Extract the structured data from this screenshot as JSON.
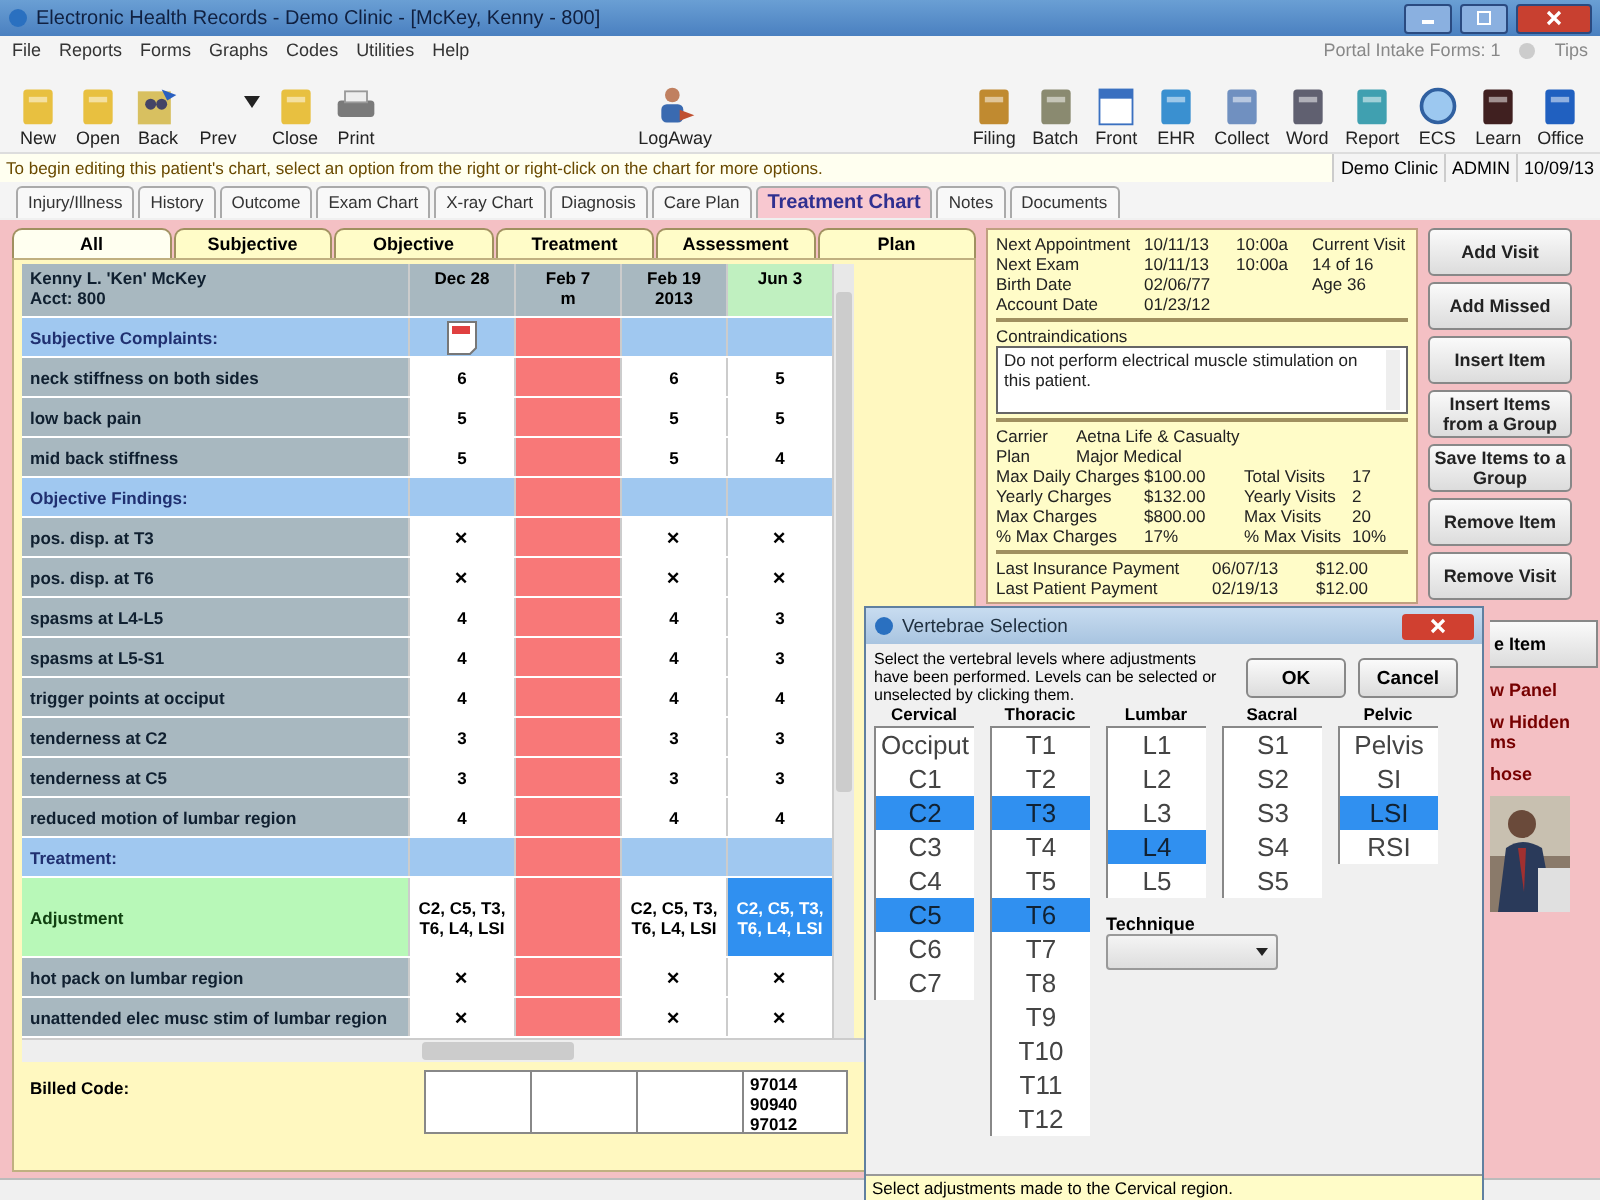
{
  "window": {
    "title": "Electronic Health Records - Demo Clinic - [McKey, Kenny - 800]"
  },
  "menu": [
    "File",
    "Reports",
    "Forms",
    "Graphs",
    "Codes",
    "Utilities",
    "Help"
  ],
  "portal": {
    "label": "Portal Intake Forms: 1",
    "tips": "Tips"
  },
  "toolbar_left": [
    {
      "label": "New"
    },
    {
      "label": "Open"
    },
    {
      "label": "Back"
    },
    {
      "label": "Prev",
      "dropdown": true
    },
    {
      "label": "Close"
    },
    {
      "label": "Print"
    }
  ],
  "toolbar_center": [
    {
      "label": "LogAway"
    }
  ],
  "toolbar_right": [
    {
      "label": "Filing"
    },
    {
      "label": "Batch"
    },
    {
      "label": "Front"
    },
    {
      "label": "EHR"
    },
    {
      "label": "Collect"
    },
    {
      "label": "Word"
    },
    {
      "label": "Report"
    },
    {
      "label": "ECS"
    },
    {
      "label": "Learn"
    },
    {
      "label": "Office"
    }
  ],
  "hint": "To begin editing this patient's chart, select an option from the right or right-click on the chart for more options.",
  "status_cells": [
    "Demo Clinic",
    "ADMIN",
    "10/09/13"
  ],
  "tabs": [
    {
      "label": "Injury/Illness",
      "selected": false
    },
    {
      "label": "History",
      "selected": false
    },
    {
      "label": "Outcome",
      "selected": false
    },
    {
      "label": "Exam Chart",
      "selected": false
    },
    {
      "label": "X-ray Chart",
      "selected": false
    },
    {
      "label": "Diagnosis",
      "selected": false
    },
    {
      "label": "Care Plan",
      "selected": false
    },
    {
      "label": "Treatment Chart",
      "selected": true
    },
    {
      "label": "Notes",
      "selected": false
    },
    {
      "label": "Documents",
      "selected": false
    }
  ],
  "chart_tabs": [
    {
      "label": "All",
      "selected": true
    },
    {
      "label": "Subjective",
      "selected": false
    },
    {
      "label": "Objective",
      "selected": false
    },
    {
      "label": "Treatment",
      "selected": false
    },
    {
      "label": "Assessment",
      "selected": false
    },
    {
      "label": "Plan",
      "selected": false
    }
  ],
  "patient": {
    "name": "Kenny L. 'Ken' McKey",
    "account": "Acct: 800"
  },
  "columns": [
    {
      "date": "Dec 28",
      "note": true,
      "missed": false,
      "current": false
    },
    {
      "date": "Feb 7",
      "sub": "m",
      "note": false,
      "missed": true,
      "current": false
    },
    {
      "date": "Feb 19",
      "sub": "2013",
      "note": false,
      "missed": false,
      "current": false
    },
    {
      "date": "Jun 3",
      "note": false,
      "missed": false,
      "current": true,
      "billed_codes": [
        "97014",
        "90940",
        "97012"
      ]
    }
  ],
  "rows": [
    {
      "kind": "section",
      "label": "Subjective Complaints:"
    },
    {
      "kind": "item",
      "label": "neck stiffness on both sides",
      "values": [
        "6",
        "6",
        "5"
      ]
    },
    {
      "kind": "item",
      "label": "low back pain",
      "values": [
        "5",
        "5",
        "5"
      ]
    },
    {
      "kind": "item",
      "label": "mid back stiffness",
      "values": [
        "5",
        "5",
        "4"
      ]
    },
    {
      "kind": "section",
      "label": "Objective Findings:"
    },
    {
      "kind": "item",
      "label": "pos. disp. at T3",
      "values": [
        "✕",
        "✕",
        "✕"
      ]
    },
    {
      "kind": "item",
      "label": "pos. disp. at T6",
      "values": [
        "✕",
        "✕",
        "✕"
      ]
    },
    {
      "kind": "item",
      "label": "spasms at L4-L5",
      "values": [
        "4",
        "4",
        "3"
      ]
    },
    {
      "kind": "item",
      "label": "spasms at L5-S1",
      "values": [
        "4",
        "4",
        "3"
      ]
    },
    {
      "kind": "item",
      "label": "trigger points at occiput",
      "values": [
        "4",
        "4",
        "4"
      ]
    },
    {
      "kind": "item",
      "label": "tenderness at C2",
      "values": [
        "3",
        "3",
        "3"
      ]
    },
    {
      "kind": "item",
      "label": "tenderness at C5",
      "values": [
        "3",
        "3",
        "3"
      ]
    },
    {
      "kind": "item",
      "label": "reduced motion of lumbar region",
      "values": [
        "4",
        "4",
        "4"
      ]
    },
    {
      "kind": "section",
      "label": "Treatment:"
    },
    {
      "kind": "adjustment",
      "label": "Adjustment",
      "values": [
        "C2, C5, T3, T6, L4, LSI",
        "C2, C5, T3, T6, L4, LSI",
        "C2, C5, T3, T6, L4, LSI"
      ],
      "selected": [
        false,
        false,
        true
      ]
    },
    {
      "kind": "item",
      "label": "hot pack on lumbar region",
      "values": [
        "✕",
        "✕",
        "✕"
      ]
    },
    {
      "kind": "item",
      "label": "unattended elec musc stim of lumbar region",
      "values": [
        "✕",
        "✕",
        "✕"
      ]
    }
  ],
  "billed_label": "Billed Code:",
  "appointments": [
    {
      "label": "Next Appointment",
      "date": "10/11/13",
      "time": "10:00a",
      "extra": "Current Visit"
    },
    {
      "label": "Next Exam",
      "date": "10/11/13",
      "time": "10:00a",
      "extra": "14 of 16"
    },
    {
      "label": "Birth Date",
      "date": "02/06/77",
      "extra": "Age 36"
    },
    {
      "label": "Account Date",
      "date": "01/23/12"
    }
  ],
  "contraindications": {
    "label": "Contraindications",
    "text": "Do not perform electrical muscle stimulation on this patient."
  },
  "insurance": [
    {
      "label": "Carrier",
      "value": "Aetna Life & Casualty"
    },
    {
      "label": "Plan",
      "value": "Major Medical"
    }
  ],
  "charges": [
    {
      "label": "Max Daily Charges",
      "value": "$100.00",
      "label2": "Total Visits",
      "value2": "17"
    },
    {
      "label": "Yearly Charges",
      "value": "$132.00",
      "label2": "Yearly Visits",
      "value2": "2"
    },
    {
      "label": "Max Charges",
      "value": "$800.00",
      "label2": "Max Visits",
      "value2": "20"
    },
    {
      "label": "% Max Charges",
      "value": "17%",
      "label2": "% Max Visits",
      "value2": "10%"
    }
  ],
  "payments": [
    {
      "label": "Last Insurance Payment",
      "date": "06/07/13",
      "amount": "$12.00"
    },
    {
      "label": "Last Patient Payment",
      "date": "02/19/13",
      "amount": "$12.00"
    }
  ],
  "actions": [
    "Add Visit",
    "Add Missed",
    "Insert Item",
    "Insert Items from a Group",
    "Save Items to a Group",
    "Remove Item",
    "Remove Visit"
  ],
  "partial_actions": [
    {
      "kind": "button",
      "label": "e Item"
    },
    {
      "kind": "link",
      "label": "w Panel"
    },
    {
      "kind": "link",
      "label": "w Hidden ms"
    },
    {
      "kind": "link",
      "label": "hose"
    },
    {
      "kind": "picture"
    }
  ],
  "dialog": {
    "title": "Vertebrae Selection",
    "instructions": "Select the vertebral levels where adjustments have been performed. Levels can be selected or unselected by clicking them.",
    "ok": "OK",
    "cancel": "Cancel",
    "regions": [
      {
        "name": "Cervical",
        "items": [
          {
            "label": "Occiput",
            "selected": false
          },
          {
            "label": "C1",
            "selected": false
          },
          {
            "label": "C2",
            "selected": true
          },
          {
            "label": "C3",
            "selected": false
          },
          {
            "label": "C4",
            "selected": false
          },
          {
            "label": "C5",
            "selected": true
          },
          {
            "label": "C6",
            "selected": false
          },
          {
            "label": "C7",
            "selected": false
          }
        ]
      },
      {
        "name": "Thoracic",
        "items": [
          {
            "label": "T1",
            "selected": false
          },
          {
            "label": "T2",
            "selected": false
          },
          {
            "label": "T3",
            "selected": true
          },
          {
            "label": "T4",
            "selected": false
          },
          {
            "label": "T5",
            "selected": false
          },
          {
            "label": "T6",
            "selected": true
          },
          {
            "label": "T7",
            "selected": false
          },
          {
            "label": "T8",
            "selected": false
          },
          {
            "label": "T9",
            "selected": false
          },
          {
            "label": "T10",
            "selected": false
          },
          {
            "label": "T11",
            "selected": false
          },
          {
            "label": "T12",
            "selected": false
          }
        ]
      },
      {
        "name": "Lumbar",
        "items": [
          {
            "label": "L1",
            "selected": false
          },
          {
            "label": "L2",
            "selected": false
          },
          {
            "label": "L3",
            "selected": false
          },
          {
            "label": "L4",
            "selected": true
          },
          {
            "label": "L5",
            "selected": false
          }
        ]
      },
      {
        "name": "Sacral",
        "items": [
          {
            "label": "S1",
            "selected": false
          },
          {
            "label": "S2",
            "selected": false
          },
          {
            "label": "S3",
            "selected": false
          },
          {
            "label": "S4",
            "selected": false
          },
          {
            "label": "S5",
            "selected": false
          }
        ]
      },
      {
        "name": "Pelvic",
        "items": [
          {
            "label": "Pelvis",
            "selected": false
          },
          {
            "label": "SI",
            "selected": false
          },
          {
            "label": "LSI",
            "selected": true
          },
          {
            "label": "RSI",
            "selected": false
          }
        ]
      }
    ],
    "technique_label": "Technique",
    "status": "Select adjustments made to the Cervical region."
  }
}
